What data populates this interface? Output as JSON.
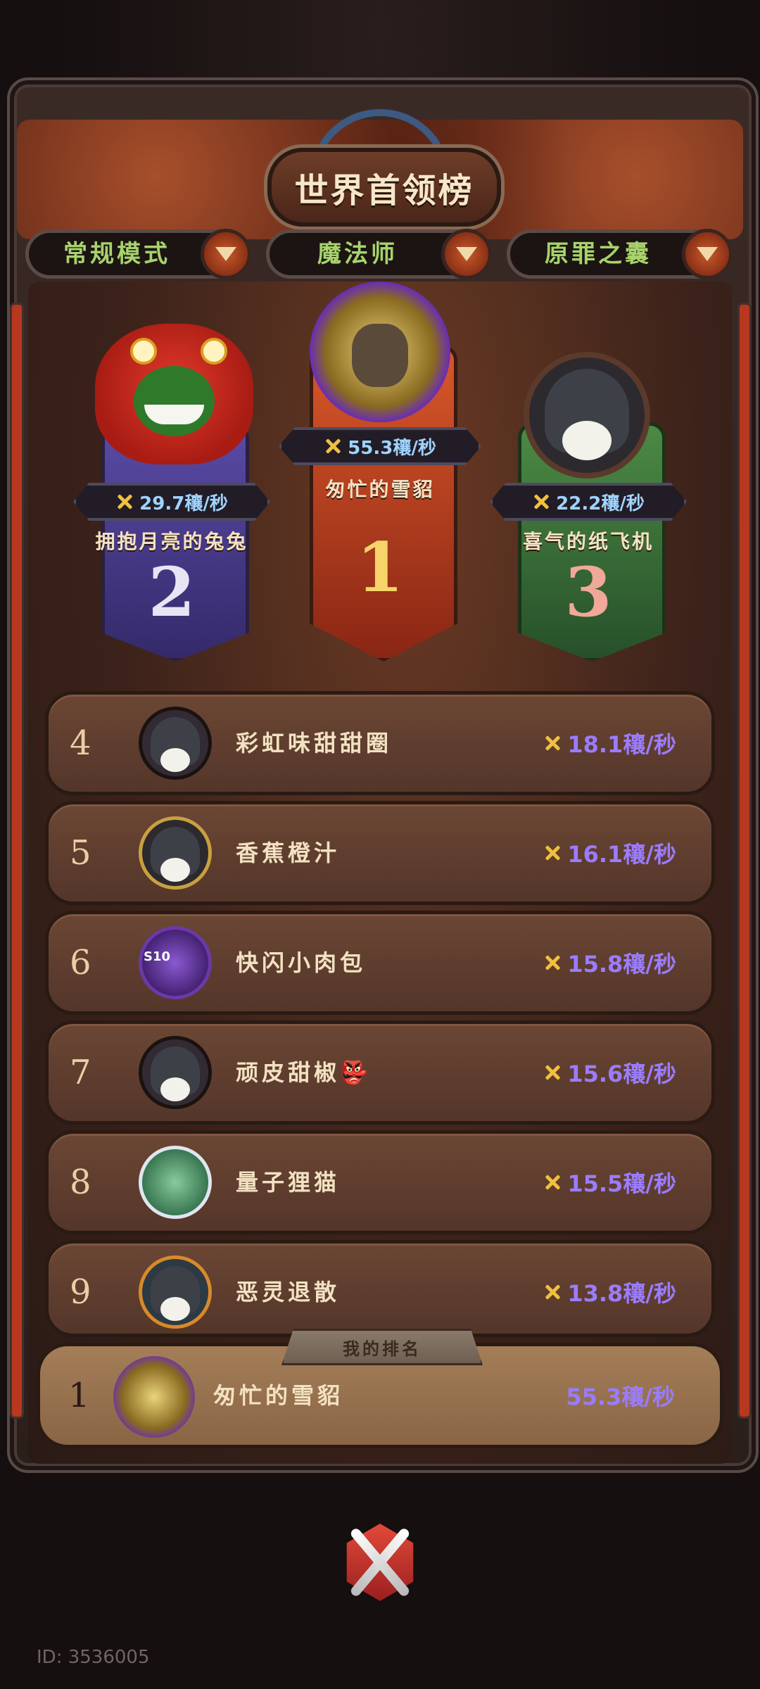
{
  "header": {
    "title": "世界首领榜"
  },
  "tabs": [
    {
      "label": "常规模式"
    },
    {
      "label": "魔法师"
    },
    {
      "label": "原罪之囊"
    }
  ],
  "podium": [
    {
      "rank": "1",
      "name": "匆忙的雪貂",
      "score": "55.3穰/秒",
      "color": "#c9461f"
    },
    {
      "rank": "2",
      "name": "拥抱月亮的兔兔",
      "score": "29.7穰/秒",
      "color": "#4b3d8f"
    },
    {
      "rank": "3",
      "name": "喜气的纸飞机",
      "score": "22.2穰/秒",
      "color": "#3f7a3a"
    }
  ],
  "list": [
    {
      "rank": "4",
      "name": "彩虹味甜甜圈",
      "score": "18.1穰/秒",
      "avatar": "hooded-avatar"
    },
    {
      "rank": "5",
      "name": "香蕉橙汁",
      "score": "16.1穰/秒",
      "avatar": "dragon-frame-avatar"
    },
    {
      "rank": "6",
      "name": "快闪小肉包",
      "score": "15.8穰/秒",
      "avatar": "s10-tentacle-avatar",
      "badge": "S10"
    },
    {
      "rank": "7",
      "name": "顽皮甜椒👺",
      "score": "15.6穰/秒",
      "avatar": "hooded-avatar"
    },
    {
      "rank": "8",
      "name": "量子狸猫",
      "score": "15.5穰/秒",
      "avatar": "astronaut-avatar"
    },
    {
      "rank": "9",
      "name": "恶灵退散",
      "score": "13.8穰/秒",
      "avatar": "rocket-avatar"
    }
  ],
  "my_rank": {
    "label": "我的排名",
    "rank": "1",
    "name": "匆忙的雪貂",
    "score": "55.3穰/秒"
  },
  "footer": {
    "user_id": "ID: 3536005"
  },
  "colors": {
    "accent_score": "#9a7cff",
    "podium_score": "#9fd3ff",
    "tab_text": "#a7d36b"
  }
}
